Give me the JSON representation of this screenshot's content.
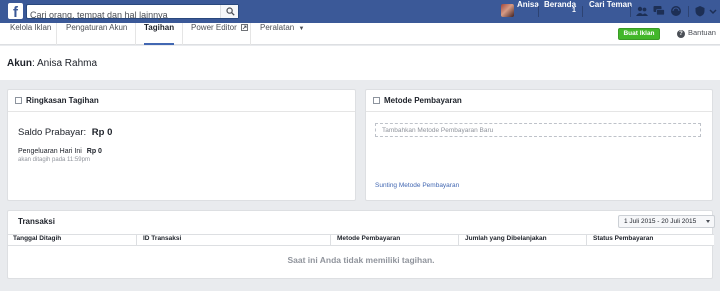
{
  "topbar": {
    "search_placeholder": "Cari orang, tempat dan hal lainnya",
    "user_name": "Anisa",
    "home_label": "Beranda",
    "home_badge": "1",
    "find_friends_label": "Cari Teman",
    "icons": [
      "friend-requests-icon",
      "messages-icon",
      "notifications-icon",
      "privacy-icon"
    ],
    "bar_color": "#3b5998"
  },
  "subnav": {
    "tabs": [
      {
        "label": "Kelola Iklan"
      },
      {
        "label": "Pengaturan Akun"
      },
      {
        "label": "Tagihan",
        "active": true
      },
      {
        "label": "Power Editor"
      },
      {
        "label": "Peralatan"
      }
    ],
    "create_ad_label": "Buat Iklan",
    "help_label": "Bantuan",
    "accent": "#42b72a"
  },
  "account": {
    "label": "Akun",
    "name": "Anisa Rahma"
  },
  "billing_summary": {
    "title": "Ringkasan Tagihan",
    "balance_label": "Saldo Prabayar:",
    "balance_value": "Rp 0",
    "today_label": "Pengeluaran Hari Ini",
    "today_value": "Rp 0",
    "billed_note": "akan ditagih pada 11:59pm"
  },
  "payment_methods": {
    "title": "Metode Pembayaran",
    "add_label": "Tambahkan Metode Pembayaran Baru",
    "edit_label": "Sunting Metode Pembayaran"
  },
  "transactions": {
    "title": "Transaksi",
    "date_range": "1 Juli 2015 - 20 Juli 2015",
    "columns": [
      "Tanggal Ditagih",
      "ID Transaksi",
      "Metode Pembayaran",
      "Jumlah yang Dibelanjakan",
      "Status Pembayaran"
    ],
    "empty_message": "Saat ini Anda tidak memiliki tagihan."
  }
}
